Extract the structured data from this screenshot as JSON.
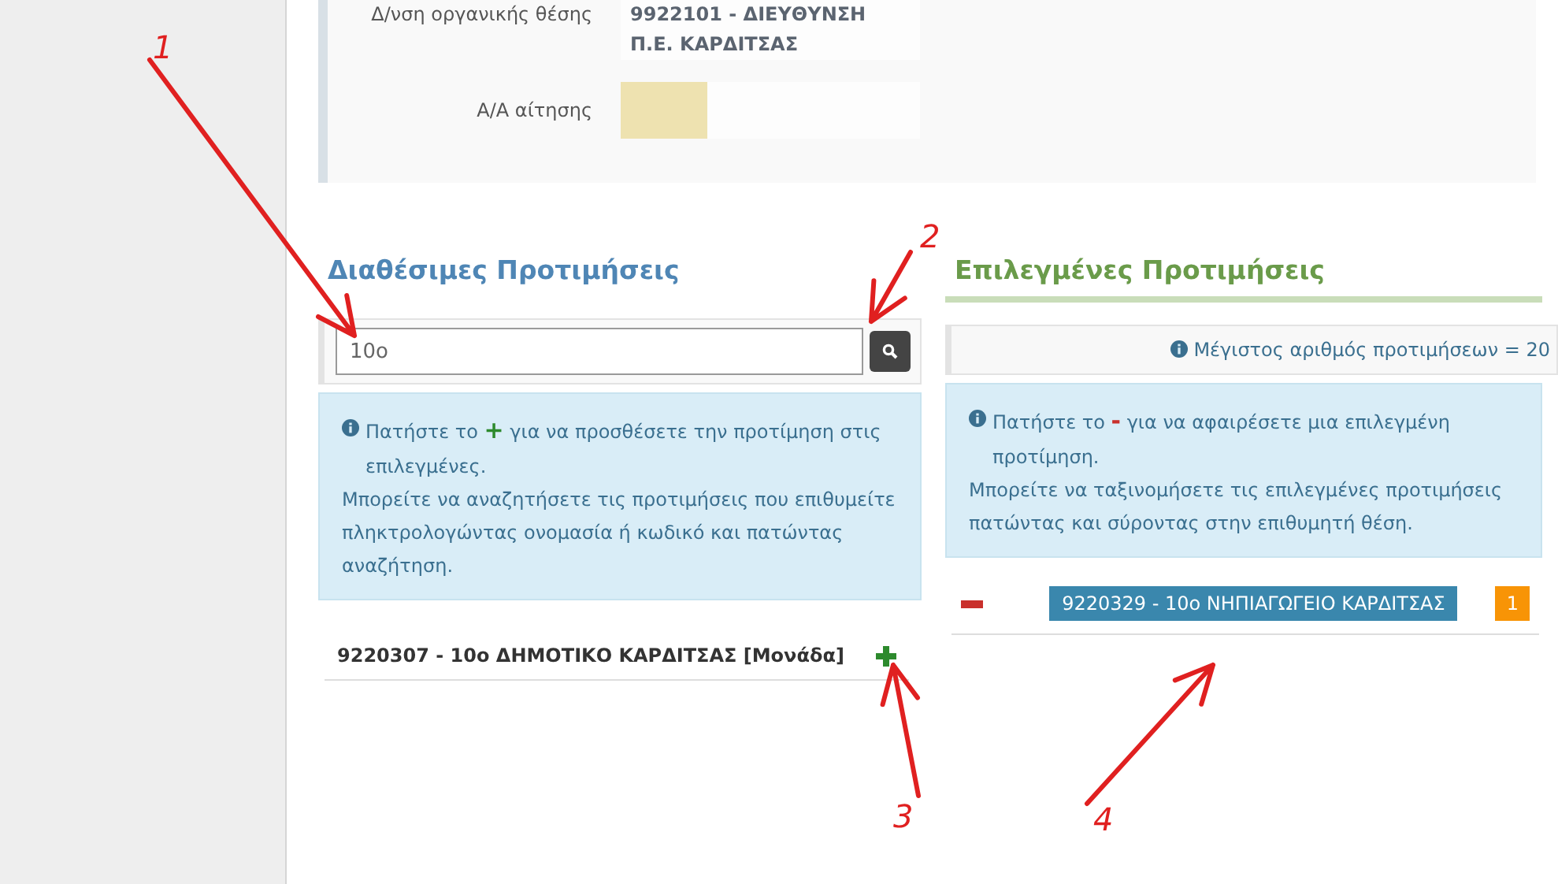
{
  "panel": {
    "fields": [
      {
        "label": "Δ/νση οργανικής θέσης",
        "kind": "text",
        "value": "9922101 - ΔΙΕΥΘΥΝΣΗ Π.Ε. ΚΑΡΔΙΤΣΑΣ"
      },
      {
        "label": "Α/Α αίτησης",
        "kind": "highlight"
      }
    ]
  },
  "available": {
    "title": "Διαθέσιμες Προτιμήσεις",
    "search": {
      "value": "10ο"
    },
    "info": {
      "before": "Πατήστε το",
      "symbol": "+",
      "after": "για να προσθέσετε την προτίμηση στις επιλεγμένες.",
      "more": "Μπορείτε να αναζητήσετε τις προτιμήσεις που επιθυμείτε πληκτρολογώντας ονομασία ή κωδικό και πατώντας αναζήτηση."
    },
    "items": [
      {
        "label": "9220307 - 10ο ΔΗΜΟΤΙΚΟ ΚΑΡΔΙΤΣΑΣ [Μονάδα]"
      }
    ]
  },
  "selected": {
    "title": "Επιλεγμένες Προτιμήσεις",
    "max_note": "Μέγιστος αριθμός προτιμήσεων = 20",
    "info": {
      "before": "Πατήστε το",
      "symbol": "-",
      "after": "για να αφαιρέσετε μια επιλεγμένη προτίμηση.",
      "more": "Μπορείτε να ταξινομήσετε τις επιλεγμένες προτιμήσεις πατώντας και σύροντας στην επιθυμητή θέση."
    },
    "items": [
      {
        "label": "9220329 - 10ο ΝΗΠΙΑΓΩΓΕΙΟ ΚΑΡΔΙΤΣΑΣ",
        "rank": "1"
      }
    ]
  },
  "annotations": [
    {
      "number": "1"
    },
    {
      "number": "2"
    },
    {
      "number": "3"
    },
    {
      "number": "4"
    }
  ]
}
